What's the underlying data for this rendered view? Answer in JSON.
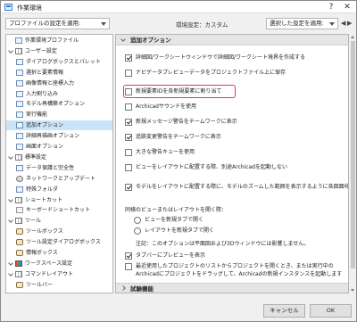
{
  "window": {
    "title": "作業環境",
    "help": "?",
    "close": "✕"
  },
  "topbar": {
    "left_select": "プロファイルの設定を適用:",
    "env_title": "環境設定：カスタム",
    "right_select": "選択した設定を適用:",
    "prev": "◀",
    "next": "▶"
  },
  "tree": [
    {
      "label": "作業環境プロファイル",
      "level": 0,
      "icon": "doc",
      "expand": false
    },
    {
      "label": "ユーザー設定",
      "level": 0,
      "icon": "grid",
      "expand": true
    },
    {
      "label": "ダイアログボックスとパレット",
      "level": 1,
      "icon": "doc",
      "expand": false
    },
    {
      "label": "選択と要素情報",
      "level": 1,
      "icon": "doc",
      "expand": false
    },
    {
      "label": "画像情報と座標入力",
      "level": 1,
      "icon": "doc",
      "expand": false
    },
    {
      "label": "入力割り込み",
      "level": 1,
      "icon": "doc",
      "expand": false
    },
    {
      "label": "モデル再構築オプション",
      "level": 1,
      "icon": "doc",
      "expand": false
    },
    {
      "label": "実行機能",
      "level": 1,
      "icon": "doc",
      "expand": false
    },
    {
      "label": "追加オプション",
      "level": 1,
      "icon": "doc",
      "expand": false,
      "selected": true
    },
    {
      "label": "詳細再描画オプション",
      "level": 1,
      "icon": "doc",
      "expand": false
    },
    {
      "label": "画面オプション",
      "level": 1,
      "icon": "doc",
      "expand": false
    },
    {
      "label": "標準設定",
      "level": 0,
      "icon": "grid",
      "expand": true
    },
    {
      "label": "データ保護と完全性",
      "level": 1,
      "icon": "doc",
      "expand": false
    },
    {
      "label": "ネットワークとアップデート",
      "level": 1,
      "icon": "gear",
      "expand": false
    },
    {
      "label": "特殊フォルダ",
      "level": 1,
      "icon": "doc",
      "expand": false
    },
    {
      "label": "ショートカット",
      "level": 0,
      "icon": "grid",
      "expand": true
    },
    {
      "label": "キーボードショートカット",
      "level": 1,
      "icon": "key",
      "expand": false
    },
    {
      "label": "ツール",
      "level": 0,
      "icon": "grid",
      "expand": true
    },
    {
      "label": "ツールボックス",
      "level": 1,
      "icon": "tool",
      "expand": false
    },
    {
      "label": "ツール設定ダイアログボックス",
      "level": 1,
      "icon": "tool",
      "expand": false
    },
    {
      "label": "情報ボックス",
      "level": 1,
      "icon": "tool",
      "expand": false
    },
    {
      "label": "ワークスペース設定",
      "level": 0,
      "icon": "color",
      "expand": true
    },
    {
      "label": "コマンドレイアウト",
      "level": 0,
      "icon": "grid",
      "expand": true
    },
    {
      "label": "ツールバー",
      "level": 1,
      "icon": "tool",
      "expand": false
    }
  ],
  "panel": {
    "section1": "追加オプション",
    "options": [
      {
        "label": "詳細図/ワークシートウィンドウで詳細図/ワークシート境界を作成する",
        "checked": true
      },
      {
        "label": "ナビゲータプレビューデータをプロジェクトファイル上に保存",
        "checked": false
      },
      {
        "label": "新規要素IDを各新規要素に割り当て",
        "checked": false,
        "highlight": true
      },
      {
        "label": "Archicadサウンドを使用",
        "checked": false
      },
      {
        "label": "新規メッセージ警告をチームワークに表示",
        "checked": true
      },
      {
        "label": "追跡変更警告をチームワークに表示",
        "checked": true
      },
      {
        "label": "大きな警告キューを使用",
        "checked": false
      },
      {
        "label": "ビューをレイアウトに配置する際、別途Archicadを起動しない",
        "checked": false
      },
      {
        "label": "モデルをレイアウトに配置する際に、モデルのズームした範囲を表示するように各図面枠を調整します",
        "checked": true
      }
    ],
    "view_question": "同様のビューまたはレイアウトを開く際：",
    "radios": [
      {
        "label": "ビューを新規タブで開く"
      },
      {
        "label": "レイアウトを新規タブで開く"
      }
    ],
    "note": "注記：このオプションは平面図および3Dウィンドウには影響しません。",
    "tab_preview": {
      "label": "タブバーにプレビューを表示",
      "checked": true
    },
    "recent": {
      "label": "最近使用したプロジェクトのリストからプロジェクトを開くとき、または実行中のArchicadにプロジェクトをドラッグして、Archicadの新規インスタンスを起動します",
      "checked": false
    },
    "section2": "試験機能"
  },
  "buttons": {
    "cancel": "キャンセル",
    "ok": "OK"
  }
}
